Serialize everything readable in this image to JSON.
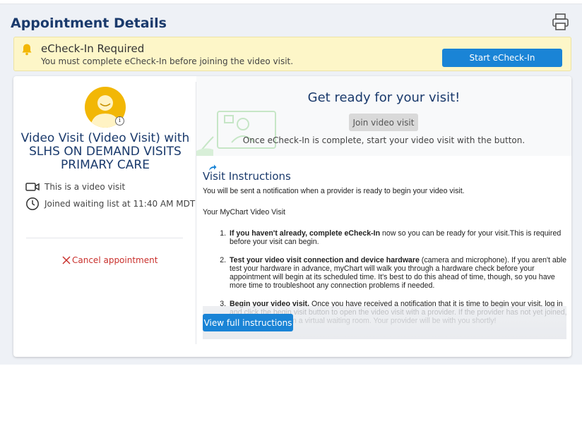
{
  "header": {
    "title": "Appointment Details"
  },
  "banner": {
    "title": "eCheck-In Required",
    "message": "You must complete eCheck-In before joining the video visit.",
    "button_label": "Start eCheck-In"
  },
  "left_panel": {
    "visit_title": "Video Visit (Video Visit) with SLHS ON DEMAND VISITS PRIMARY CARE",
    "video_note": "This is a video visit",
    "waiting_note": "Joined waiting list at 11:40 AM MDT",
    "cancel_label": "Cancel appointment",
    "info_glyph": "i"
  },
  "ready": {
    "title": "Get ready for your visit!",
    "join_label": "Join video visit",
    "text": "Once eCheck-In is complete, start your video visit with the button."
  },
  "instructions": {
    "title": "Visit Instructions",
    "intro": "You will be sent a notification when a provider is ready to begin your video visit.",
    "subtitle": "Your MyChart Video Visit",
    "steps": [
      {
        "bold": "If you haven't already, complete eCheck-In",
        "text": " now so you can be ready for your visit.This is required before your visit can begin."
      },
      {
        "bold": "Test your video visit connection and device hardware",
        "text": " (camera and microphone). If you aren't able test your hardware in advance, myChart will walk you through a hardware check before your appointment will begin at its scheduled time. It's best to do this ahead of time, though, so you have more time to troubleshoot any connection problems if needed."
      },
      {
        "bold": "Begin your video visit.",
        "text": " Once you have received a notification that it is time to begin your visit, log in and click the begin visit button to open the video visit with a provider. If the provider has not yet joined, you will be placed in a virtual waiting room. Your provider will be with you shortly!"
      }
    ],
    "full_label": "View full instructions"
  },
  "colors": {
    "accent": "#1a84d6",
    "heading": "#1a3a6c",
    "banner_bg": "#fdf6c8",
    "cancel": "#c9302c",
    "avatar": "#f2b705"
  },
  "icons": [
    "print-icon",
    "bell-icon",
    "avatar-icon",
    "info-icon",
    "video-camera-icon",
    "clock-icon",
    "close-x-icon",
    "share-arrow-icon"
  ]
}
